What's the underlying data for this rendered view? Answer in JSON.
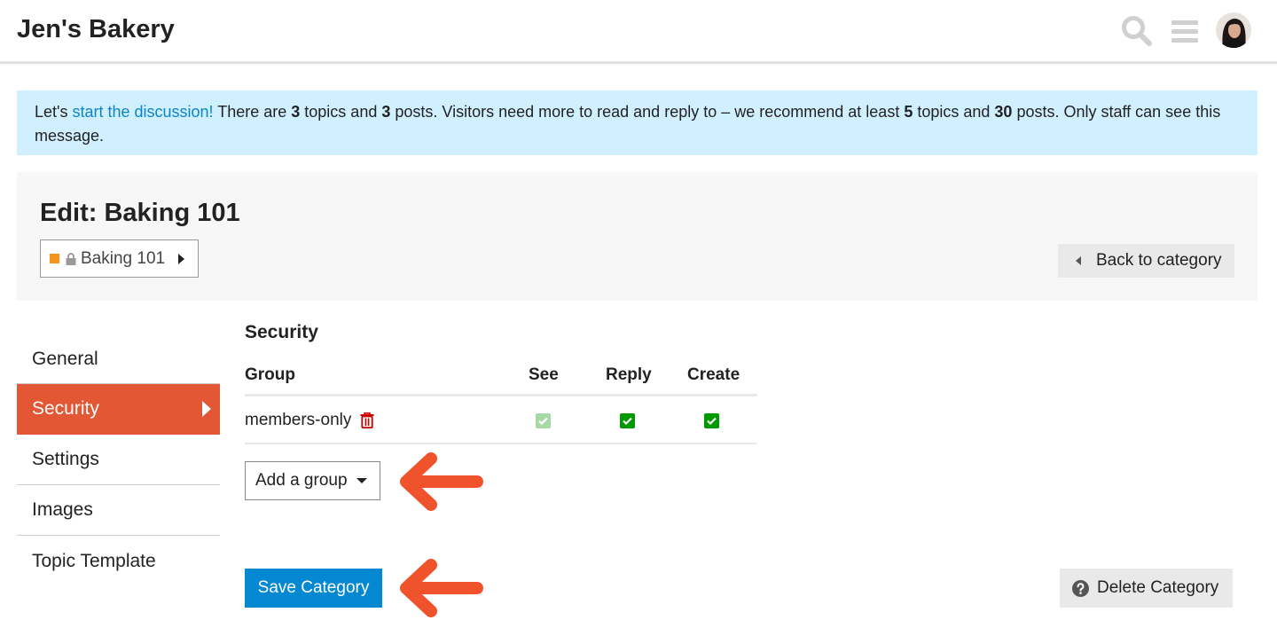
{
  "header": {
    "site_title": "Jen's Bakery",
    "icons": [
      "search-icon",
      "menu-icon",
      "avatar"
    ]
  },
  "notice": {
    "prefix": "Let's ",
    "link": "start the discussion!",
    "t1": " There are ",
    "topics_count": "3",
    "t2": " topics and ",
    "posts_count": "3",
    "t3": " posts. Visitors need more to read and reply to – we recommend at least ",
    "rec_topics": "5",
    "t4": " topics and ",
    "rec_posts": "30",
    "t5": " posts. Only staff can see this message."
  },
  "edit": {
    "title": "Edit: Baking 101",
    "category_badge": {
      "label": "Baking 101",
      "color": "#f7941d",
      "locked": true
    },
    "back_button": "Back to category"
  },
  "nav": {
    "items": [
      {
        "label": "General",
        "active": false
      },
      {
        "label": "Security",
        "active": true
      },
      {
        "label": "Settings",
        "active": false
      },
      {
        "label": "Images",
        "active": false
      },
      {
        "label": "Topic Template",
        "active": false
      }
    ]
  },
  "security": {
    "title": "Security",
    "columns": [
      "Group",
      "See",
      "Reply",
      "Create"
    ],
    "rows": [
      {
        "group": "members-only",
        "see": true,
        "see_disabled": true,
        "reply": true,
        "create": true
      }
    ],
    "add_group_label": "Add a group",
    "save_label": "Save Category",
    "delete_label": "Delete Category"
  },
  "colors": {
    "accent": "#e45735",
    "primary_button": "#0388d1",
    "notice_bg": "#d1f0ff",
    "checkbox_on": "#009900",
    "annotation_arrow": "#f0522b"
  }
}
